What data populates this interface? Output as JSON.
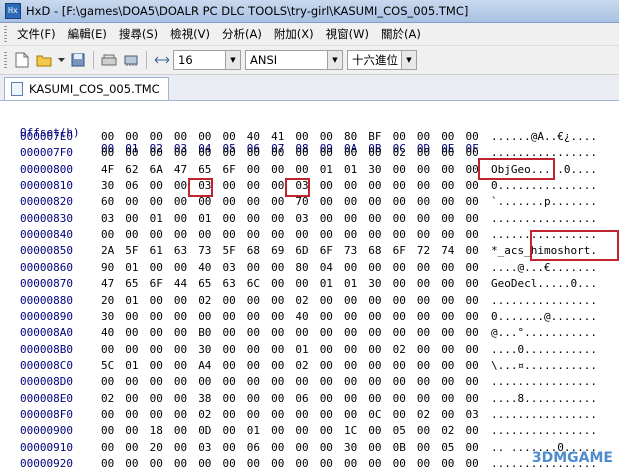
{
  "window": {
    "title": "HxD - [F:\\games\\DOA5\\DOALR PC DLC TOOLS\\try-girl\\KASUMI_COS_005.TMC]"
  },
  "menu": [
    {
      "label": "文件(F)"
    },
    {
      "label": "編輯(E)"
    },
    {
      "label": "搜尋(S)"
    },
    {
      "label": "檢視(V)"
    },
    {
      "label": "分析(A)"
    },
    {
      "label": "附加(X)"
    },
    {
      "label": "視窗(W)"
    },
    {
      "label": "關於(A)"
    }
  ],
  "toolbar": {
    "bytes_per_row": "16",
    "charset": "ANSI",
    "offset_base": "十六進位"
  },
  "tab": {
    "label": "KASUMI_COS_005.TMC"
  },
  "hex": {
    "header_label": "Offset(h)",
    "columns": [
      "00",
      "01",
      "02",
      "03",
      "04",
      "05",
      "06",
      "07",
      "08",
      "09",
      "0A",
      "0B",
      "0C",
      "0D",
      "0E",
      "0F"
    ],
    "rows": [
      {
        "offset": "000007E0",
        "bytes": [
          "00",
          "00",
          "00",
          "00",
          "00",
          "00",
          "40",
          "41",
          "00",
          "00",
          "80",
          "BF",
          "00",
          "00",
          "00",
          "00"
        ],
        "ascii": "......@A..€¿...."
      },
      {
        "offset": "000007F0",
        "bytes": [
          "00",
          "00",
          "00",
          "00",
          "00",
          "00",
          "00",
          "00",
          "00",
          "00",
          "00",
          "00",
          "02",
          "00",
          "00",
          "00"
        ],
        "ascii": "................"
      },
      {
        "offset": "00000800",
        "bytes": [
          "4F",
          "62",
          "6A",
          "47",
          "65",
          "6F",
          "00",
          "00",
          "00",
          "01",
          "01",
          "30",
          "00",
          "00",
          "00",
          "00"
        ],
        "ascii": "ObjGeo.....0...."
      },
      {
        "offset": "00000810",
        "bytes": [
          "30",
          "06",
          "00",
          "00",
          "03",
          "00",
          "00",
          "00",
          "03",
          "00",
          "00",
          "00",
          "00",
          "00",
          "00",
          "00"
        ],
        "ascii": "0..............."
      },
      {
        "offset": "00000820",
        "bytes": [
          "60",
          "00",
          "00",
          "00",
          "00",
          "00",
          "00",
          "00",
          "70",
          "00",
          "00",
          "00",
          "00",
          "00",
          "00",
          "00"
        ],
        "ascii": "`.......p......."
      },
      {
        "offset": "00000830",
        "bytes": [
          "03",
          "00",
          "01",
          "00",
          "01",
          "00",
          "00",
          "00",
          "03",
          "00",
          "00",
          "00",
          "00",
          "00",
          "00",
          "00"
        ],
        "ascii": "................"
      },
      {
        "offset": "00000840",
        "bytes": [
          "00",
          "00",
          "00",
          "00",
          "00",
          "00",
          "00",
          "00",
          "00",
          "00",
          "00",
          "00",
          "00",
          "00",
          "00",
          "00"
        ],
        "ascii": "................"
      },
      {
        "offset": "00000850",
        "bytes": [
          "2A",
          "5F",
          "61",
          "63",
          "73",
          "5F",
          "68",
          "69",
          "6D",
          "6F",
          "73",
          "68",
          "6F",
          "72",
          "74",
          "00"
        ],
        "ascii": "*_acs_himoshort."
      },
      {
        "offset": "00000860",
        "bytes": [
          "90",
          "01",
          "00",
          "00",
          "40",
          "03",
          "00",
          "00",
          "80",
          "04",
          "00",
          "00",
          "00",
          "00",
          "00",
          "00"
        ],
        "ascii": "....@...€......."
      },
      {
        "offset": "00000870",
        "bytes": [
          "47",
          "65",
          "6F",
          "44",
          "65",
          "63",
          "6C",
          "00",
          "00",
          "01",
          "01",
          "30",
          "00",
          "00",
          "00",
          "00"
        ],
        "ascii": "GeoDecl.....0..."
      },
      {
        "offset": "00000880",
        "bytes": [
          "20",
          "01",
          "00",
          "00",
          "02",
          "00",
          "00",
          "00",
          "02",
          "00",
          "00",
          "00",
          "00",
          "00",
          "00",
          "00"
        ],
        "ascii": "................"
      },
      {
        "offset": "00000890",
        "bytes": [
          "30",
          "00",
          "00",
          "00",
          "00",
          "00",
          "00",
          "00",
          "40",
          "00",
          "00",
          "00",
          "00",
          "00",
          "00",
          "00"
        ],
        "ascii": "0.......@......."
      },
      {
        "offset": "000008A0",
        "bytes": [
          "40",
          "00",
          "00",
          "00",
          "B0",
          "00",
          "00",
          "00",
          "00",
          "00",
          "00",
          "00",
          "00",
          "00",
          "00",
          "00"
        ],
        "ascii": "@...°..........."
      },
      {
        "offset": "000008B0",
        "bytes": [
          "00",
          "00",
          "00",
          "00",
          "30",
          "00",
          "00",
          "00",
          "01",
          "00",
          "00",
          "00",
          "02",
          "00",
          "00",
          "00"
        ],
        "ascii": "....0..........."
      },
      {
        "offset": "000008C0",
        "bytes": [
          "5C",
          "01",
          "00",
          "00",
          "A4",
          "00",
          "00",
          "00",
          "02",
          "00",
          "00",
          "00",
          "00",
          "00",
          "00",
          "00"
        ],
        "ascii": "\\...¤..........."
      },
      {
        "offset": "000008D0",
        "bytes": [
          "00",
          "00",
          "00",
          "00",
          "00",
          "00",
          "00",
          "00",
          "00",
          "00",
          "00",
          "00",
          "00",
          "00",
          "00",
          "00"
        ],
        "ascii": "................"
      },
      {
        "offset": "000008E0",
        "bytes": [
          "02",
          "00",
          "00",
          "00",
          "38",
          "00",
          "00",
          "00",
          "06",
          "00",
          "00",
          "00",
          "00",
          "00",
          "00",
          "00"
        ],
        "ascii": "....8..........."
      },
      {
        "offset": "000008F0",
        "bytes": [
          "00",
          "00",
          "00",
          "00",
          "02",
          "00",
          "00",
          "00",
          "00",
          "00",
          "00",
          "0C",
          "00",
          "02",
          "00",
          "03"
        ],
        "ascii": "................"
      },
      {
        "offset": "00000900",
        "bytes": [
          "00",
          "00",
          "18",
          "00",
          "0D",
          "00",
          "01",
          "00",
          "00",
          "00",
          "1C",
          "00",
          "05",
          "00",
          "02",
          "00"
        ],
        "ascii": "................"
      },
      {
        "offset": "00000910",
        "bytes": [
          "00",
          "00",
          "20",
          "00",
          "03",
          "00",
          "06",
          "00",
          "00",
          "00",
          "30",
          "00",
          "0B",
          "00",
          "05",
          "00"
        ],
        "ascii": ".. .......0....."
      },
      {
        "offset": "00000920",
        "bytes": [
          "00",
          "00",
          "00",
          "00",
          "00",
          "00",
          "00",
          "00",
          "00",
          "00",
          "00",
          "00",
          "00",
          "00",
          "00",
          "00"
        ],
        "ascii": "................"
      }
    ]
  },
  "watermark": "3DMGAME"
}
